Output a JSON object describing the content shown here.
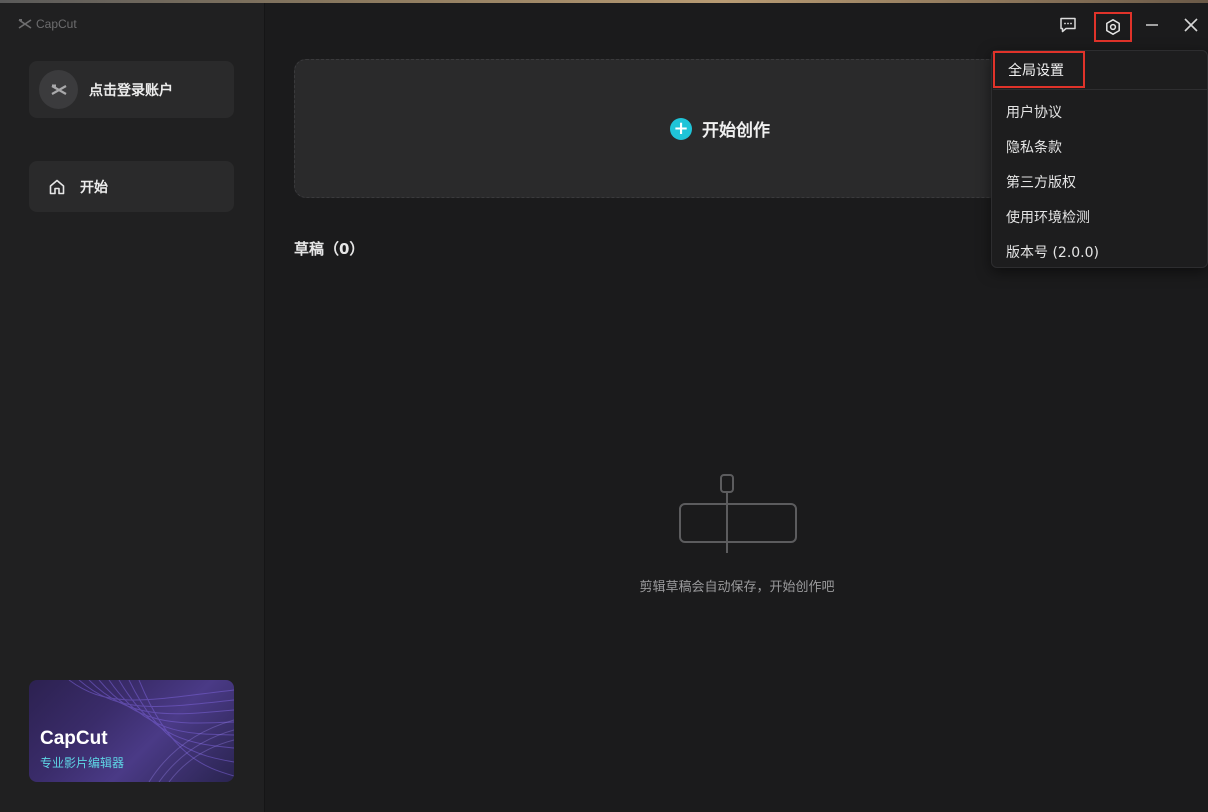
{
  "app": {
    "brand_name": "CapCut"
  },
  "sidebar": {
    "login_label": "点击登录账户",
    "nav_items": [
      {
        "label": "开始",
        "icon": "home-icon"
      }
    ],
    "promo": {
      "title": "CapCut",
      "subtitle": "专业影片编辑器"
    }
  },
  "main": {
    "create_label": "开始创作",
    "drafts_title": "草稿（0）",
    "empty_text": "剪辑草稿会自动保存，开始创作吧"
  },
  "window_controls": {
    "feedback_icon": "feedback-icon",
    "settings_icon": "settings-icon",
    "minimize_icon": "minimize-icon",
    "close_icon": "close-icon"
  },
  "settings_menu": {
    "items": [
      {
        "label": "全局设置"
      },
      {
        "label": "用户协议"
      },
      {
        "label": "隐私条款"
      },
      {
        "label": "第三方版权"
      },
      {
        "label": "使用环境检测"
      },
      {
        "label": "版本号 (2.0.0)"
      }
    ]
  },
  "colors": {
    "accent": "#1fc4d8",
    "highlight_box": "#e0332a"
  }
}
